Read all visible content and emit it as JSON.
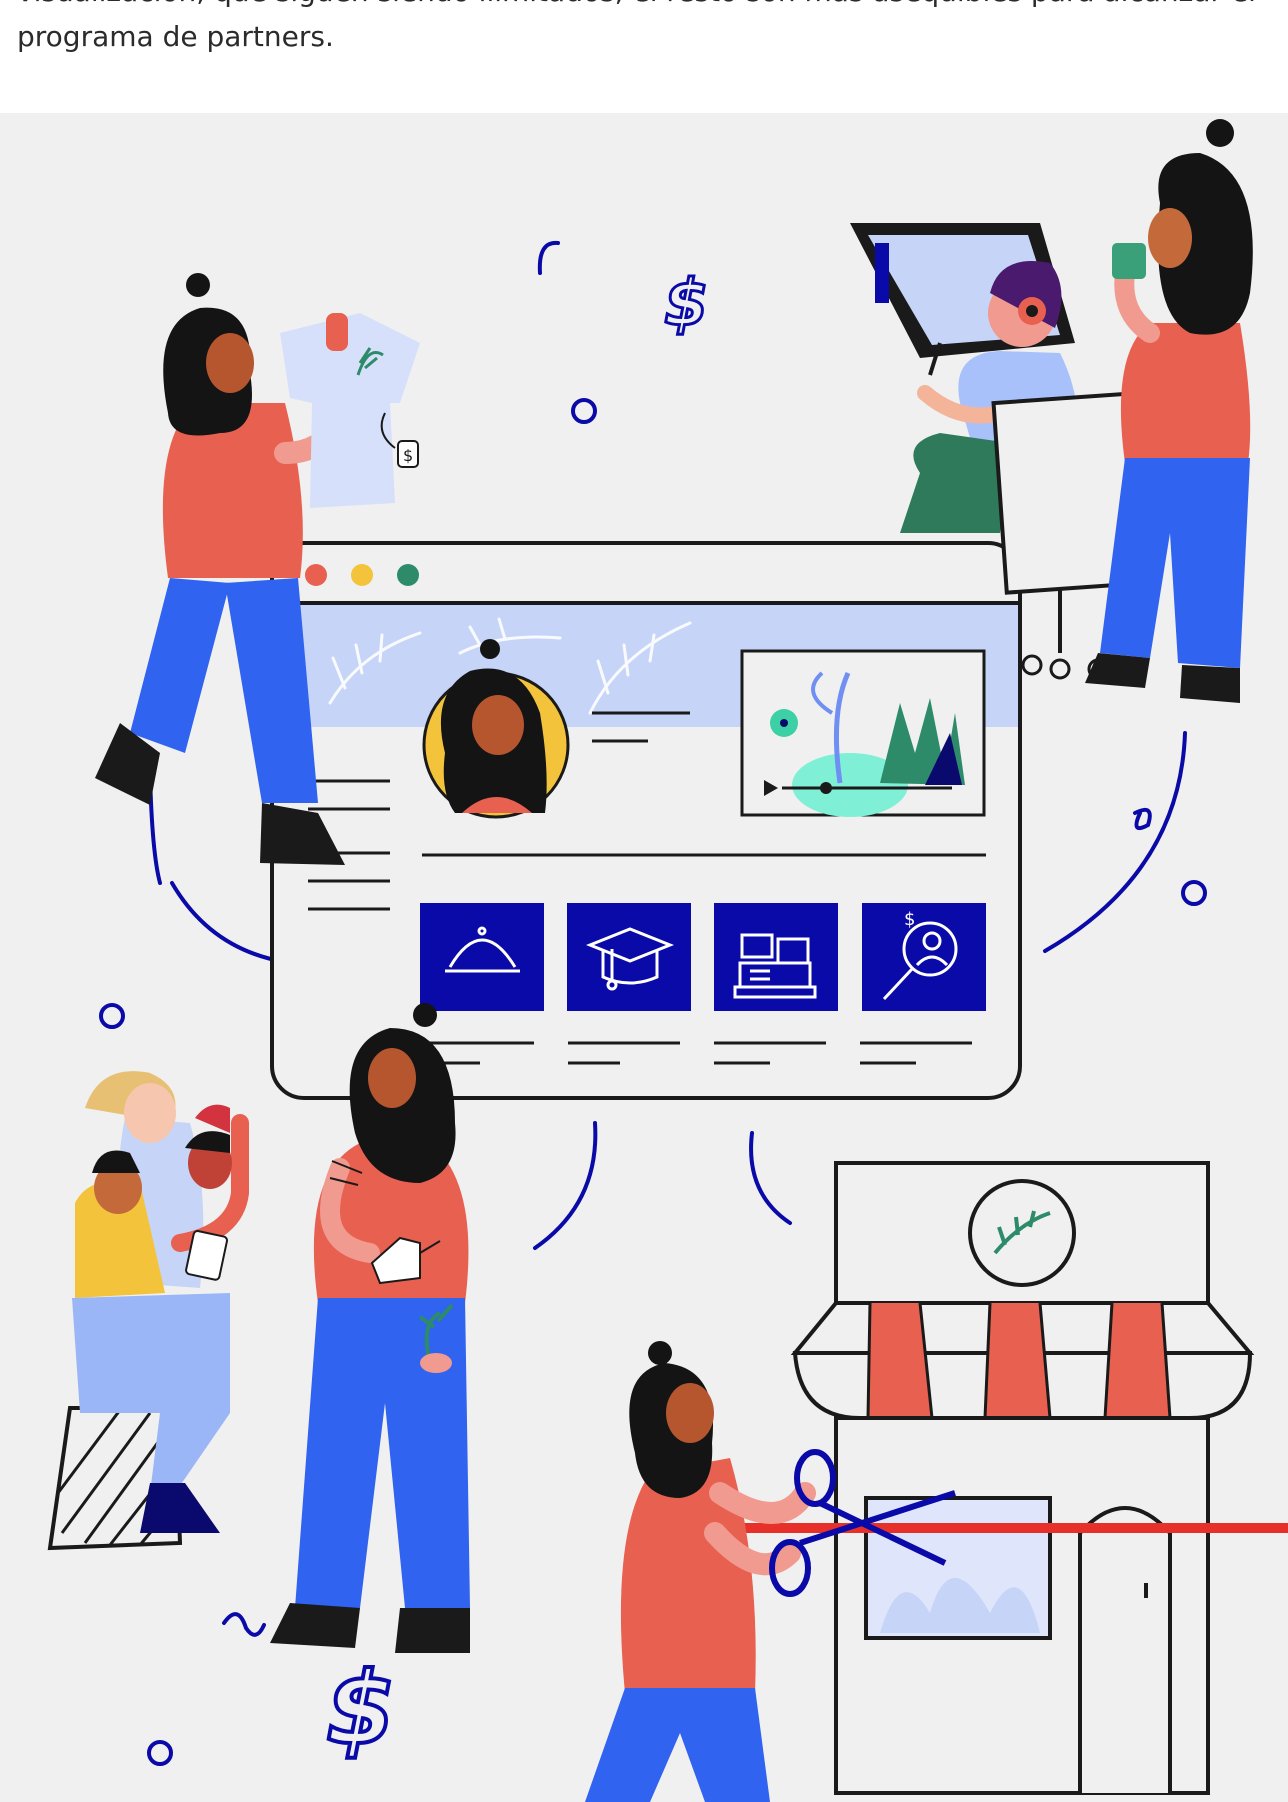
{
  "article": {
    "line1": "visualización, que siguen siendo ilimitados, el resto son más asequibles para alcanzar el",
    "line2": "programa de partners."
  },
  "illustration": {
    "price_tag_symbol": "$",
    "colors": {
      "navy": "#0a0aa8",
      "red": "#e8604f",
      "blue": "#2f63f0",
      "lightblue": "#c6d4f7",
      "yellow": "#f3c33c",
      "dark": "#1a1a1a",
      "background": "#f0f0f0"
    },
    "icons": [
      "cloche-icon",
      "graduation-cap-icon",
      "cash-register-icon",
      "customer-search-icon"
    ]
  }
}
